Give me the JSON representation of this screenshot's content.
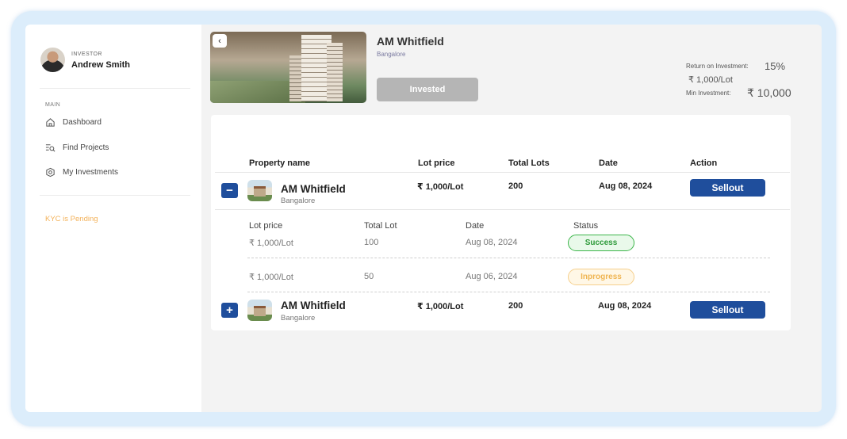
{
  "user": {
    "role": "INVESTOR",
    "name": "Andrew Smith"
  },
  "sidebar": {
    "section": "MAIN",
    "items": [
      {
        "label": "Dashboard",
        "icon": "home-icon"
      },
      {
        "label": "Find Projects",
        "icon": "search-list-icon"
      },
      {
        "label": "My Investments",
        "icon": "investment-icon"
      }
    ],
    "kyc": "KYC is Pending"
  },
  "project": {
    "back": "‹",
    "title": "AM Whitfield",
    "city": "Bangalore",
    "status_button": "Invested",
    "roi_label": "Return on Investment:",
    "roi_value": "15%",
    "lot_price": "₹ 1,000/Lot",
    "min_label": "Min Investment:",
    "min_value": "₹ 10,000"
  },
  "table": {
    "headers": [
      "Property name",
      "Lot price",
      "Total Lots",
      "Date",
      "Action"
    ],
    "rows": [
      {
        "toggle": "−",
        "name": "AM Whitfield",
        "city": "Bangalore",
        "lot_price": "₹ 1,000/Lot",
        "total_lots": "200",
        "date": "Aug 08, 2024",
        "action": "Sellout",
        "sub_headers": [
          "Lot price",
          "Total Lot",
          "Date",
          "Status"
        ],
        "sub_rows": [
          {
            "lot_price": "₹ 1,000/Lot",
            "total_lot": "100",
            "date": "Aug 08, 2024",
            "status": "Success"
          },
          {
            "lot_price": "₹ 1,000/Lot",
            "total_lot": "50",
            "date": "Aug 06, 2024",
            "status": "Inprogress"
          }
        ]
      },
      {
        "toggle": "+",
        "name": "AM Whitfield",
        "city": "Bangalore",
        "lot_price": "₹ 1,000/Lot",
        "total_lots": "200",
        "date": "Aug 08, 2024",
        "action": "Sellout"
      }
    ]
  },
  "colors": {
    "primary": "#1f4e9c",
    "kyc": "#f3b25a",
    "success": "#3cb54a",
    "progress": "#efb451"
  }
}
